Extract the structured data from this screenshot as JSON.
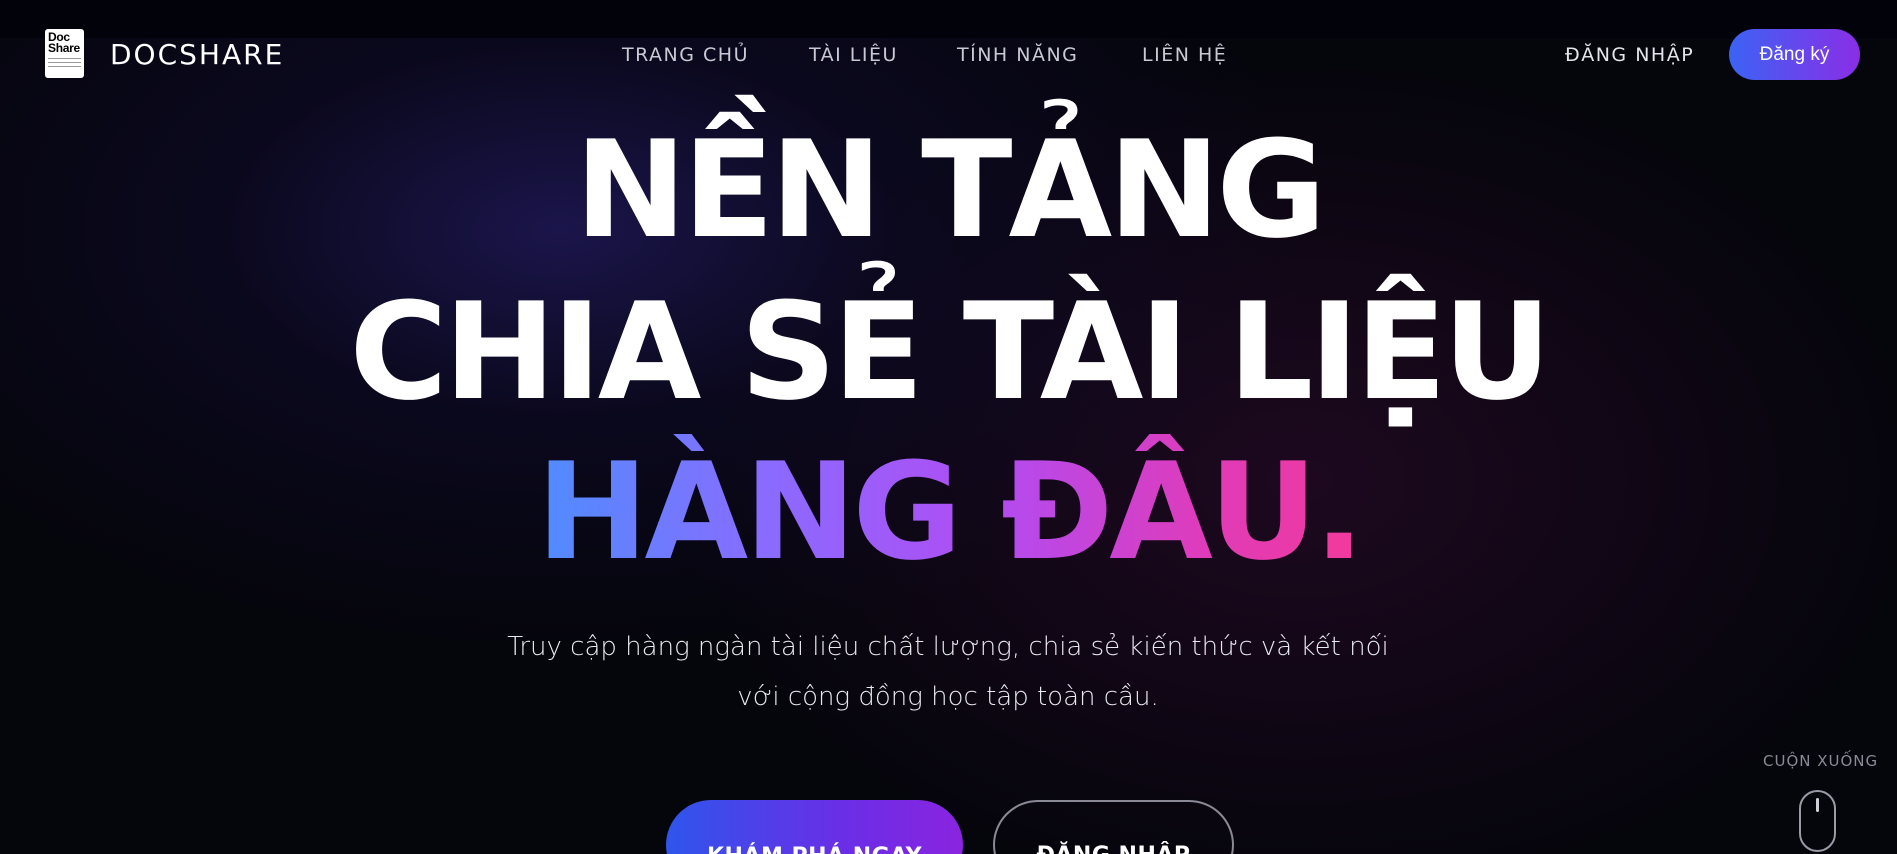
{
  "header": {
    "logo_text_line1": "Doc",
    "logo_text_line2": "Share",
    "brand": "DOCSHARE",
    "nav": [
      {
        "label": "TRANG CHỦ"
      },
      {
        "label": "TÀI LIỆU"
      },
      {
        "label": "TÍNH NĂNG"
      },
      {
        "label": "LIÊN HỆ"
      }
    ],
    "login_label": "ĐĂNG NHẬP",
    "signup_label": "Đăng ký"
  },
  "hero": {
    "line1": "NỀN TẢNG",
    "line2": "CHIA SẺ TÀI LIỆU",
    "line3": "HÀNG ĐẦU.",
    "subtitle_line1": "Truy cập hàng ngàn tài liệu chất lượng, chia sẻ kiến thức và kết nối",
    "subtitle_line2": "với cộng đồng học tập toàn cầu.",
    "primary_cta": "KHÁM PHÁ NGAY",
    "secondary_cta": "ĐĂNG NHẬP"
  },
  "scroll_hint": {
    "label": "CUỘN XUỐNG"
  },
  "colors": {
    "accent_gradient_start": "#3b63f4",
    "accent_gradient_end": "#8a2ee6",
    "headline_gradient_start": "#4f8cff",
    "headline_gradient_end": "#f23a9c",
    "background": "#05050c"
  },
  "icons": {
    "logo": "docshare-logo-icon",
    "scroll": "mouse-scroll-icon"
  }
}
